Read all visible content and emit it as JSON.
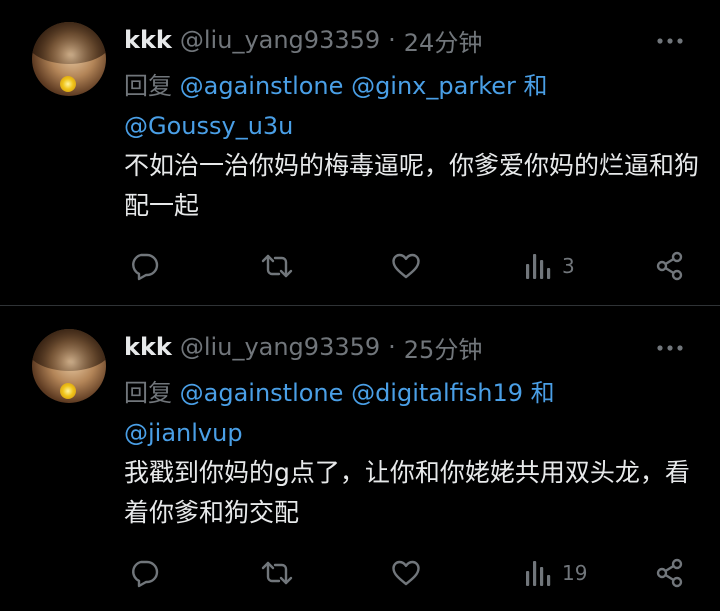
{
  "tweets": [
    {
      "display_name": "kkk",
      "handle": "@liu_yang93359",
      "separator": "·",
      "time": "24分钟",
      "reply_prefix": "回复",
      "mentions": [
        "@againstlone",
        "@ginx_parker"
      ],
      "reply_and": "和",
      "mention_last": "@Goussy_u3u",
      "text": "不如治一治你妈的梅毒逼呢，你爹爱你妈的烂逼和狗配一起",
      "views": "3"
    },
    {
      "display_name": "kkk",
      "handle": "@liu_yang93359",
      "separator": "·",
      "time": "25分钟",
      "reply_prefix": "回复",
      "mentions": [
        "@againstlone",
        "@digitalfish19"
      ],
      "reply_and": "和",
      "mention_last": "@jianlvup",
      "text": "我戳到你妈的g点了，让你和你姥姥共用双头龙，看着你爹和狗交配",
      "views": "19"
    }
  ],
  "icons": {
    "more": "more-icon",
    "reply": "reply-icon",
    "retweet": "retweet-icon",
    "like": "like-icon",
    "views": "views-icon",
    "share": "share-icon"
  },
  "colors": {
    "background": "#000000",
    "text": "#e7e9ea",
    "muted": "#71767b",
    "link": "#4a9fe6",
    "divider": "#2f3336"
  }
}
